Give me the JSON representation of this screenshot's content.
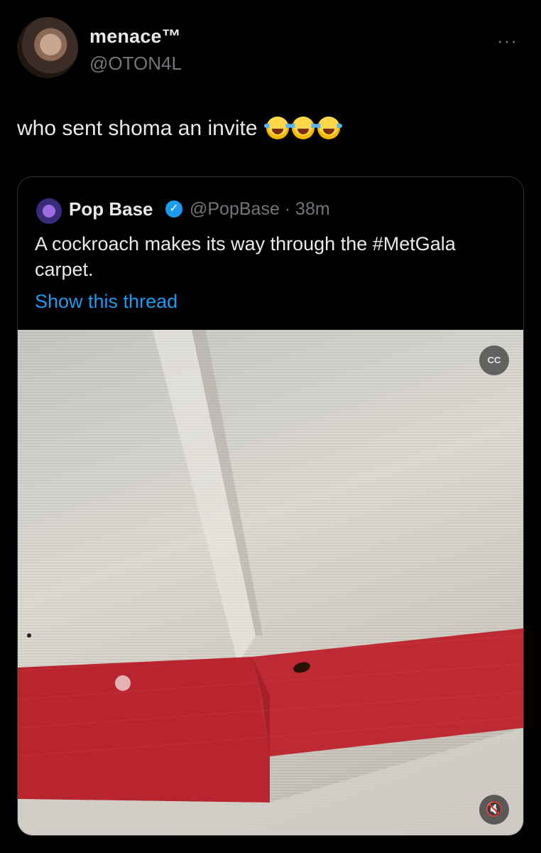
{
  "author": {
    "display_name": "menace™",
    "handle": "@OTON4L",
    "avatar_icon": "profile-photo"
  },
  "more_label": "···",
  "tweet": {
    "text": "who sent shoma an invite",
    "emoji": [
      "face-with-tears-of-joy",
      "face-with-tears-of-joy",
      "face-with-tears-of-joy"
    ]
  },
  "quote": {
    "display_name": "Pop Base",
    "verified": true,
    "handle_time": "@PopBase · 38m",
    "text": "A cockroach makes its way through the #MetGala carpet.",
    "show_thread": "Show this thread",
    "media": {
      "captions_icon": "closed-captions-off-icon",
      "captions_label": "CC",
      "mute_icon": "speaker-muted-icon",
      "mute_label": "🔇"
    }
  },
  "colors": {
    "background": "#000000",
    "text_primary": "#e7e9ea",
    "text_secondary": "#71767b",
    "link": "#1d9bf0",
    "border": "#2f3336",
    "carpet_red": "#b8252f"
  }
}
